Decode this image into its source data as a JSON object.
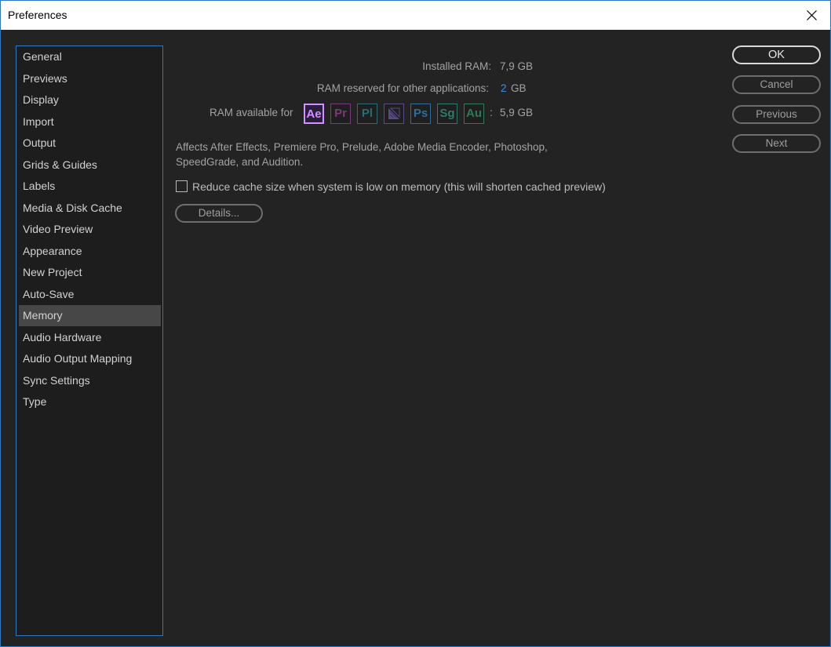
{
  "window": {
    "title": "Preferences"
  },
  "sidebar": {
    "items": [
      {
        "label": "General",
        "selected": false
      },
      {
        "label": "Previews",
        "selected": false
      },
      {
        "label": "Display",
        "selected": false
      },
      {
        "label": "Import",
        "selected": false
      },
      {
        "label": "Output",
        "selected": false
      },
      {
        "label": "Grids & Guides",
        "selected": false
      },
      {
        "label": "Labels",
        "selected": false
      },
      {
        "label": "Media & Disk Cache",
        "selected": false
      },
      {
        "label": "Video Preview",
        "selected": false
      },
      {
        "label": "Appearance",
        "selected": false
      },
      {
        "label": "New Project",
        "selected": false
      },
      {
        "label": "Auto-Save",
        "selected": false
      },
      {
        "label": "Memory",
        "selected": true
      },
      {
        "label": "Audio Hardware",
        "selected": false
      },
      {
        "label": "Audio Output Mapping",
        "selected": false
      },
      {
        "label": "Sync Settings",
        "selected": false
      },
      {
        "label": "Type",
        "selected": false
      }
    ]
  },
  "memory": {
    "installed_ram_label": "Installed RAM:",
    "installed_ram_value": "7,9 GB",
    "reserved_label": "RAM reserved for other applications:",
    "reserved_value": "2",
    "reserved_unit": "GB",
    "available_label": "RAM available for",
    "available_separator": ":",
    "available_value": "5,9 GB",
    "apps": [
      {
        "abbr": "Ae",
        "icon": "after-effects-icon",
        "color": "#d291ff",
        "active": true
      },
      {
        "abbr": "Pr",
        "icon": "premiere-pro-icon",
        "color": "#7b3a78",
        "active": false
      },
      {
        "abbr": "Pl",
        "icon": "prelude-icon",
        "color": "#2e6a72",
        "active": false
      },
      {
        "abbr": "",
        "icon": "media-encoder-icon",
        "color": "#5a4a86",
        "active": false
      },
      {
        "abbr": "Ps",
        "icon": "photoshop-icon",
        "color": "#2f6d9a",
        "active": false
      },
      {
        "abbr": "Sg",
        "icon": "speedgrade-icon",
        "color": "#2f7a6a",
        "active": false
      },
      {
        "abbr": "Au",
        "icon": "audition-icon",
        "color": "#2e7a58",
        "active": false
      }
    ],
    "description": "Affects After Effects, Premiere Pro, Prelude, Adobe Media Encoder, Photoshop, SpeedGrade, and Audition.",
    "reduce_cache_label": "Reduce cache size when system is low on memory (this will shorten cached preview)",
    "reduce_cache_checked": false,
    "details_button": "Details..."
  },
  "buttons": {
    "ok": "OK",
    "cancel": "Cancel",
    "previous": "Previous",
    "next": "Next"
  },
  "colors": {
    "accent_border": "#2b79c2",
    "value_blue": "#3e8ee6",
    "background": "#232323"
  }
}
